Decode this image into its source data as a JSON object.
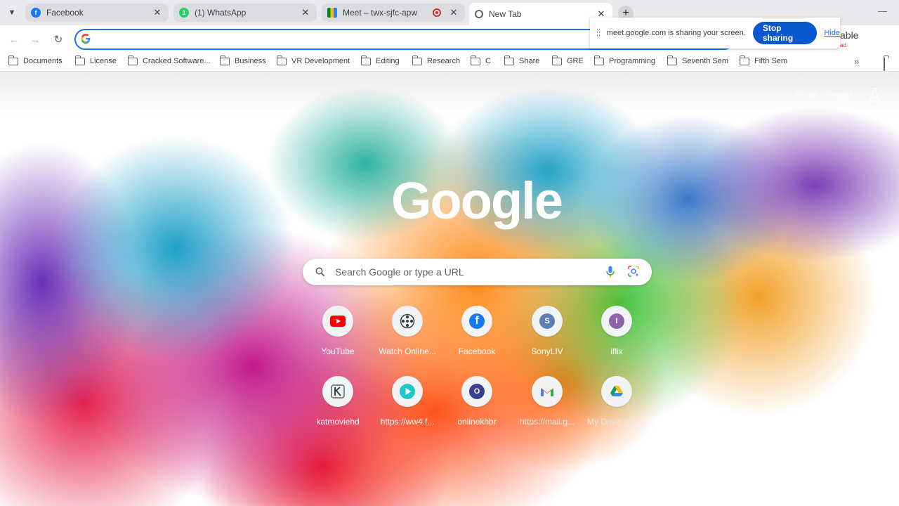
{
  "tabs": [
    {
      "title": "Facebook",
      "active": false
    },
    {
      "title": "(1) WhatsApp",
      "badge": "1",
      "active": false
    },
    {
      "title": "Meet – twx-sjfc-apw",
      "active": false
    },
    {
      "title": "New Tab",
      "active": true
    }
  ],
  "sharing_bar": {
    "message": "meet.google.com is sharing your screen.",
    "stop_label": "Stop sharing",
    "hide_label": "Hide"
  },
  "behind_popup": {
    "text": "able",
    "subtext": "ad"
  },
  "bookmarks": [
    "Documents",
    "License",
    "Cracked Software...",
    "Business",
    "VR Development",
    "Editing",
    "Research",
    "C",
    "Share",
    "GRE",
    "Programming",
    "Seventh Sem",
    "Fifth Sem"
  ],
  "page": {
    "gmail": "Gmail",
    "images": "Images",
    "logo": "Google",
    "search_placeholder": "Search Google or type a URL"
  },
  "shortcuts": [
    {
      "label": "YouTube",
      "icon": "youtube-icon",
      "color": "#ff0000"
    },
    {
      "label": "Watch Online...",
      "icon": "film-reel-icon",
      "color": "#3c4043"
    },
    {
      "label": "Facebook",
      "icon": "facebook-icon",
      "color": "#1877f2"
    },
    {
      "label": "SonyLIV",
      "icon": "s-letter-icon",
      "letter": "S",
      "color": "#5f7fb0"
    },
    {
      "label": "iflix",
      "icon": "i-letter-icon",
      "letter": "I",
      "color": "#8a63a8"
    },
    {
      "label": "katmoviehd",
      "icon": "k-logo-icon",
      "color": "#5f6368"
    },
    {
      "label": "https://ww4.f...",
      "icon": "play-icon",
      "color": "#1ec8c8"
    },
    {
      "label": "onlinekhbr",
      "icon": "o-letter-icon",
      "letter": "O",
      "color": "#3a3f8f"
    },
    {
      "label": "https://mail.g...",
      "icon": "gmail-icon",
      "color": "#ea4335"
    },
    {
      "label": "My Drive - Go...",
      "icon": "google-drive-icon",
      "color": "#fbbc04"
    }
  ]
}
